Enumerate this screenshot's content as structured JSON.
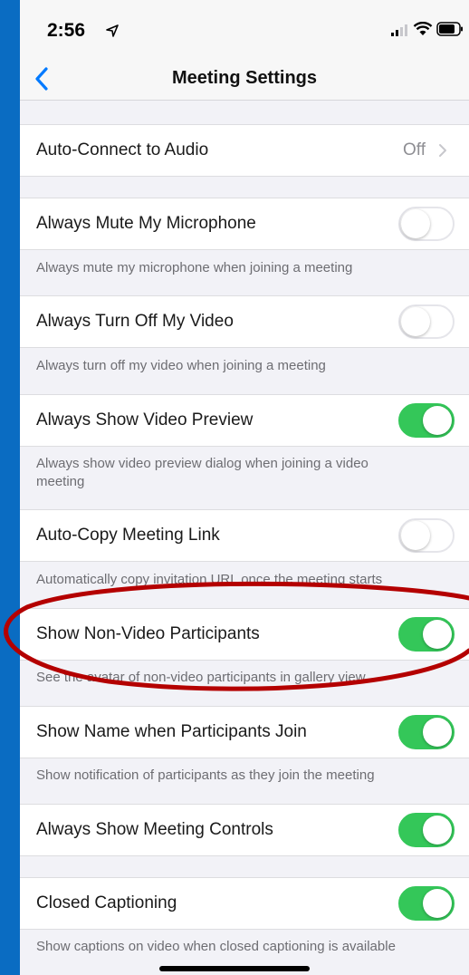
{
  "status_bar": {
    "time": "2:56"
  },
  "nav": {
    "title": "Meeting Settings"
  },
  "settings": {
    "auto_connect": {
      "label": "Auto-Connect to Audio",
      "value": "Off"
    },
    "mute_mic": {
      "label": "Always Mute My Microphone",
      "enabled": false,
      "desc": "Always mute my microphone when joining a meeting"
    },
    "video_off": {
      "label": "Always Turn Off My Video",
      "enabled": false,
      "desc": "Always turn off my video when joining a meeting"
    },
    "video_preview": {
      "label": "Always Show Video Preview",
      "enabled": true,
      "desc": "Always show video preview dialog when joining a video meeting"
    },
    "copy_link": {
      "label": "Auto-Copy Meeting Link",
      "enabled": false,
      "desc": "Automatically copy invitation URL once the meeting starts"
    },
    "non_video": {
      "label": "Show Non-Video Participants",
      "enabled": true,
      "desc": "See the avatar of non-video participants in gallery view"
    },
    "show_name": {
      "label": "Show Name when Participants Join",
      "enabled": true,
      "desc": "Show notification of participants as they join the meeting"
    },
    "meeting_controls": {
      "label": "Always Show Meeting Controls",
      "enabled": true
    },
    "captioning": {
      "label": "Closed Captioning",
      "enabled": true,
      "desc": "Show captions on video when closed captioning is available"
    }
  },
  "colors": {
    "toggle_on": "#34C759",
    "accent": "#007AFF",
    "annotation": "#B40000",
    "frame": "#0A6CC2"
  }
}
